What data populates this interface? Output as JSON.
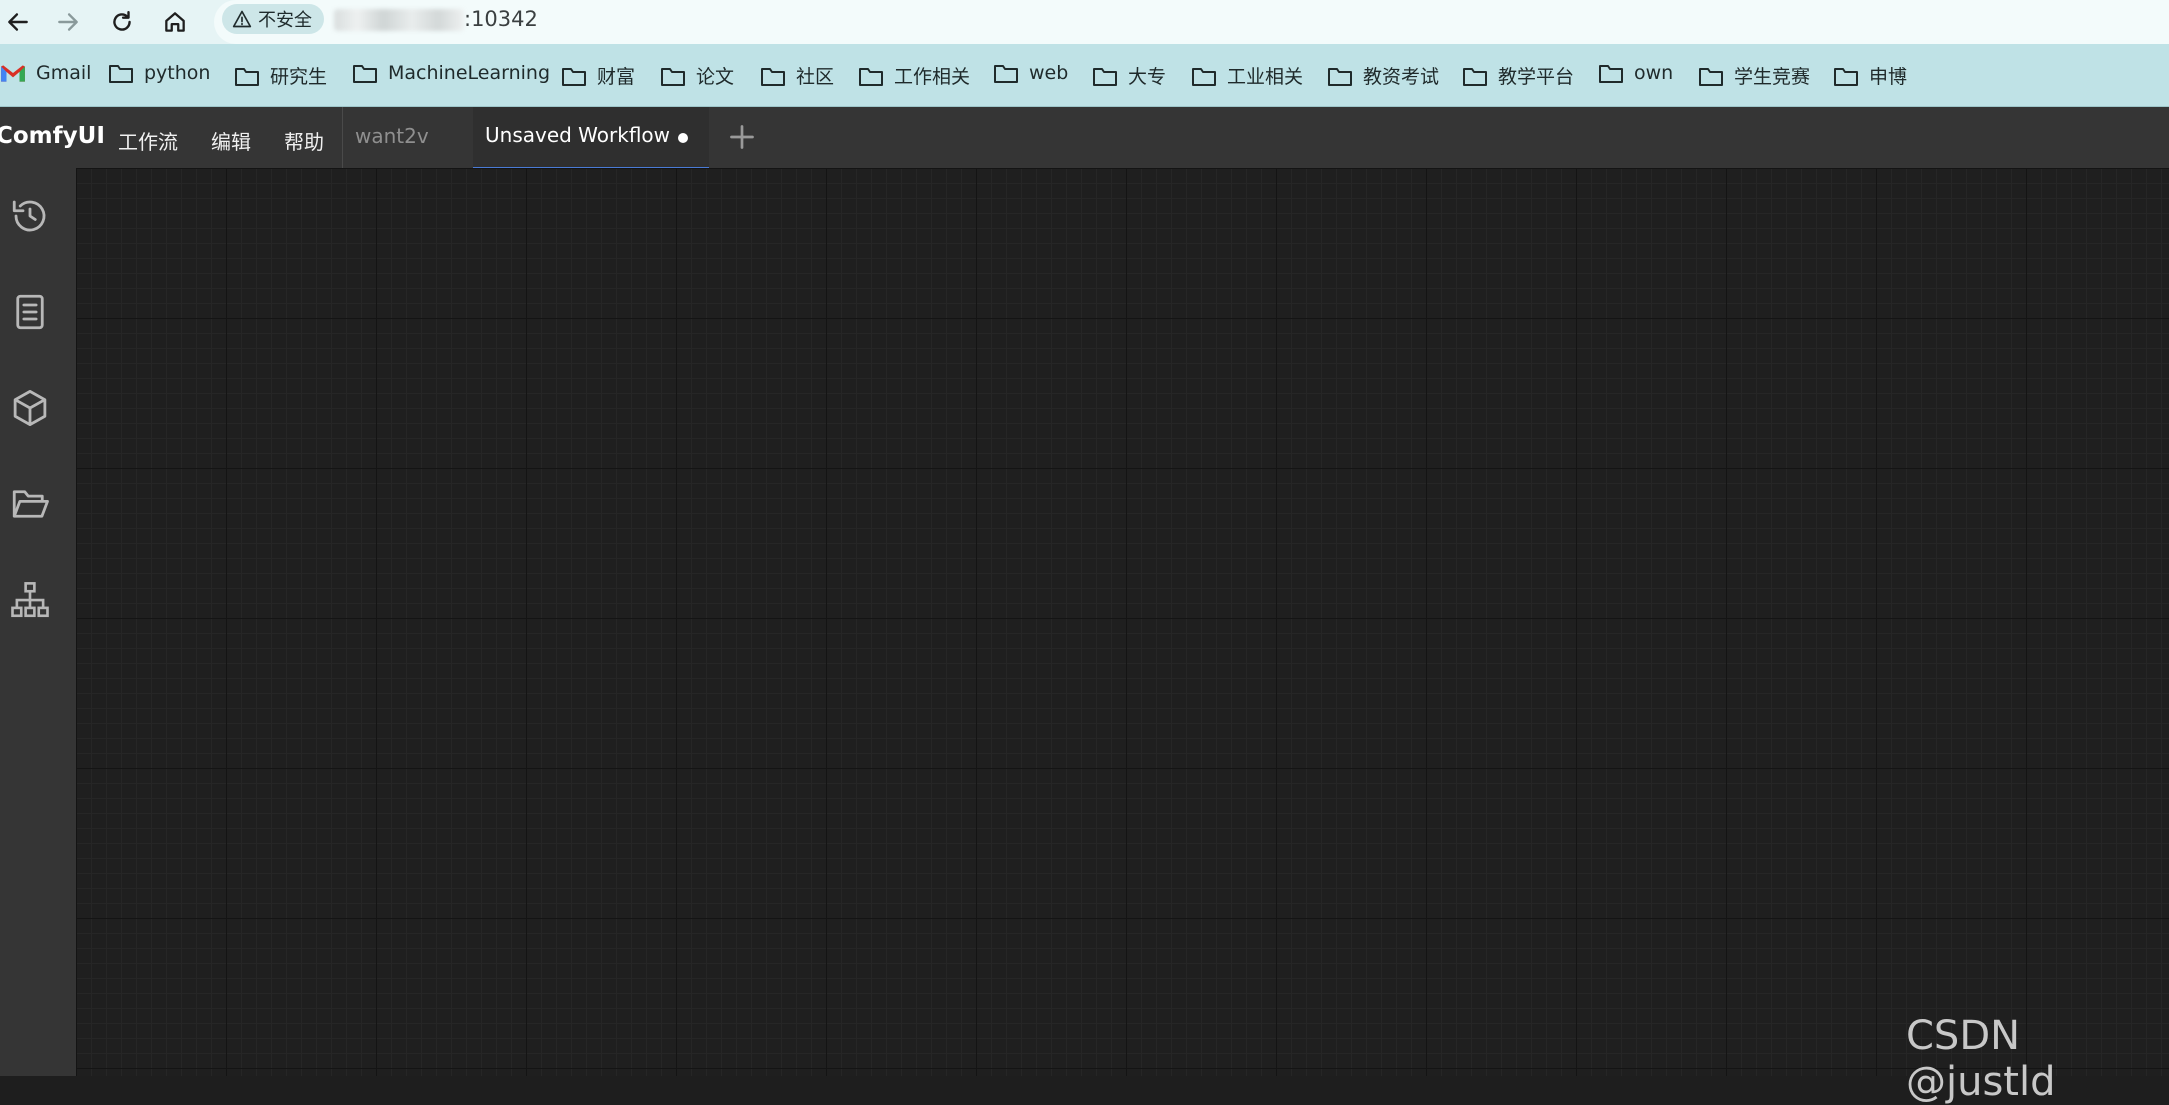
{
  "browser": {
    "security_label": "不安全",
    "url_suffix": ":10342",
    "bookmarks": [
      {
        "label": "Gmail",
        "icon": "gmail-icon"
      },
      {
        "label": "python",
        "icon": "folder-icon"
      },
      {
        "label": "研究生",
        "icon": "folder-icon"
      },
      {
        "label": "MachineLearning",
        "icon": "folder-icon"
      },
      {
        "label": "财富",
        "icon": "folder-icon"
      },
      {
        "label": "论文",
        "icon": "folder-icon"
      },
      {
        "label": "社区",
        "icon": "folder-icon"
      },
      {
        "label": "工作相关",
        "icon": "folder-icon"
      },
      {
        "label": "web",
        "icon": "folder-icon"
      },
      {
        "label": "大专",
        "icon": "folder-icon"
      },
      {
        "label": "工业相关",
        "icon": "folder-icon"
      },
      {
        "label": "教资考试",
        "icon": "folder-icon"
      },
      {
        "label": "教学平台",
        "icon": "folder-icon"
      },
      {
        "label": "own",
        "icon": "folder-icon"
      },
      {
        "label": "学生竞赛",
        "icon": "folder-icon"
      },
      {
        "label": "申博",
        "icon": "folder-icon"
      }
    ]
  },
  "app": {
    "brand": "ComfyUI",
    "menu": [
      "工作流",
      "编辑",
      "帮助"
    ],
    "tabs": [
      {
        "label": "want2v",
        "active": false
      },
      {
        "label": "Unsaved Workflow",
        "active": true,
        "unsaved": true
      }
    ],
    "sidebar_icons": [
      "history-icon",
      "book-icon",
      "cube-icon",
      "folder-open-icon",
      "sitemap-icon"
    ]
  },
  "watermark": "CSDN @justld",
  "colors": {
    "browser_bar": "#e6f4f5",
    "bookmarks_bar": "#bfe2e6",
    "menubar": "#353535",
    "canvas": "#1f1f1f",
    "active_tab_accent": "#4a7bd6"
  }
}
